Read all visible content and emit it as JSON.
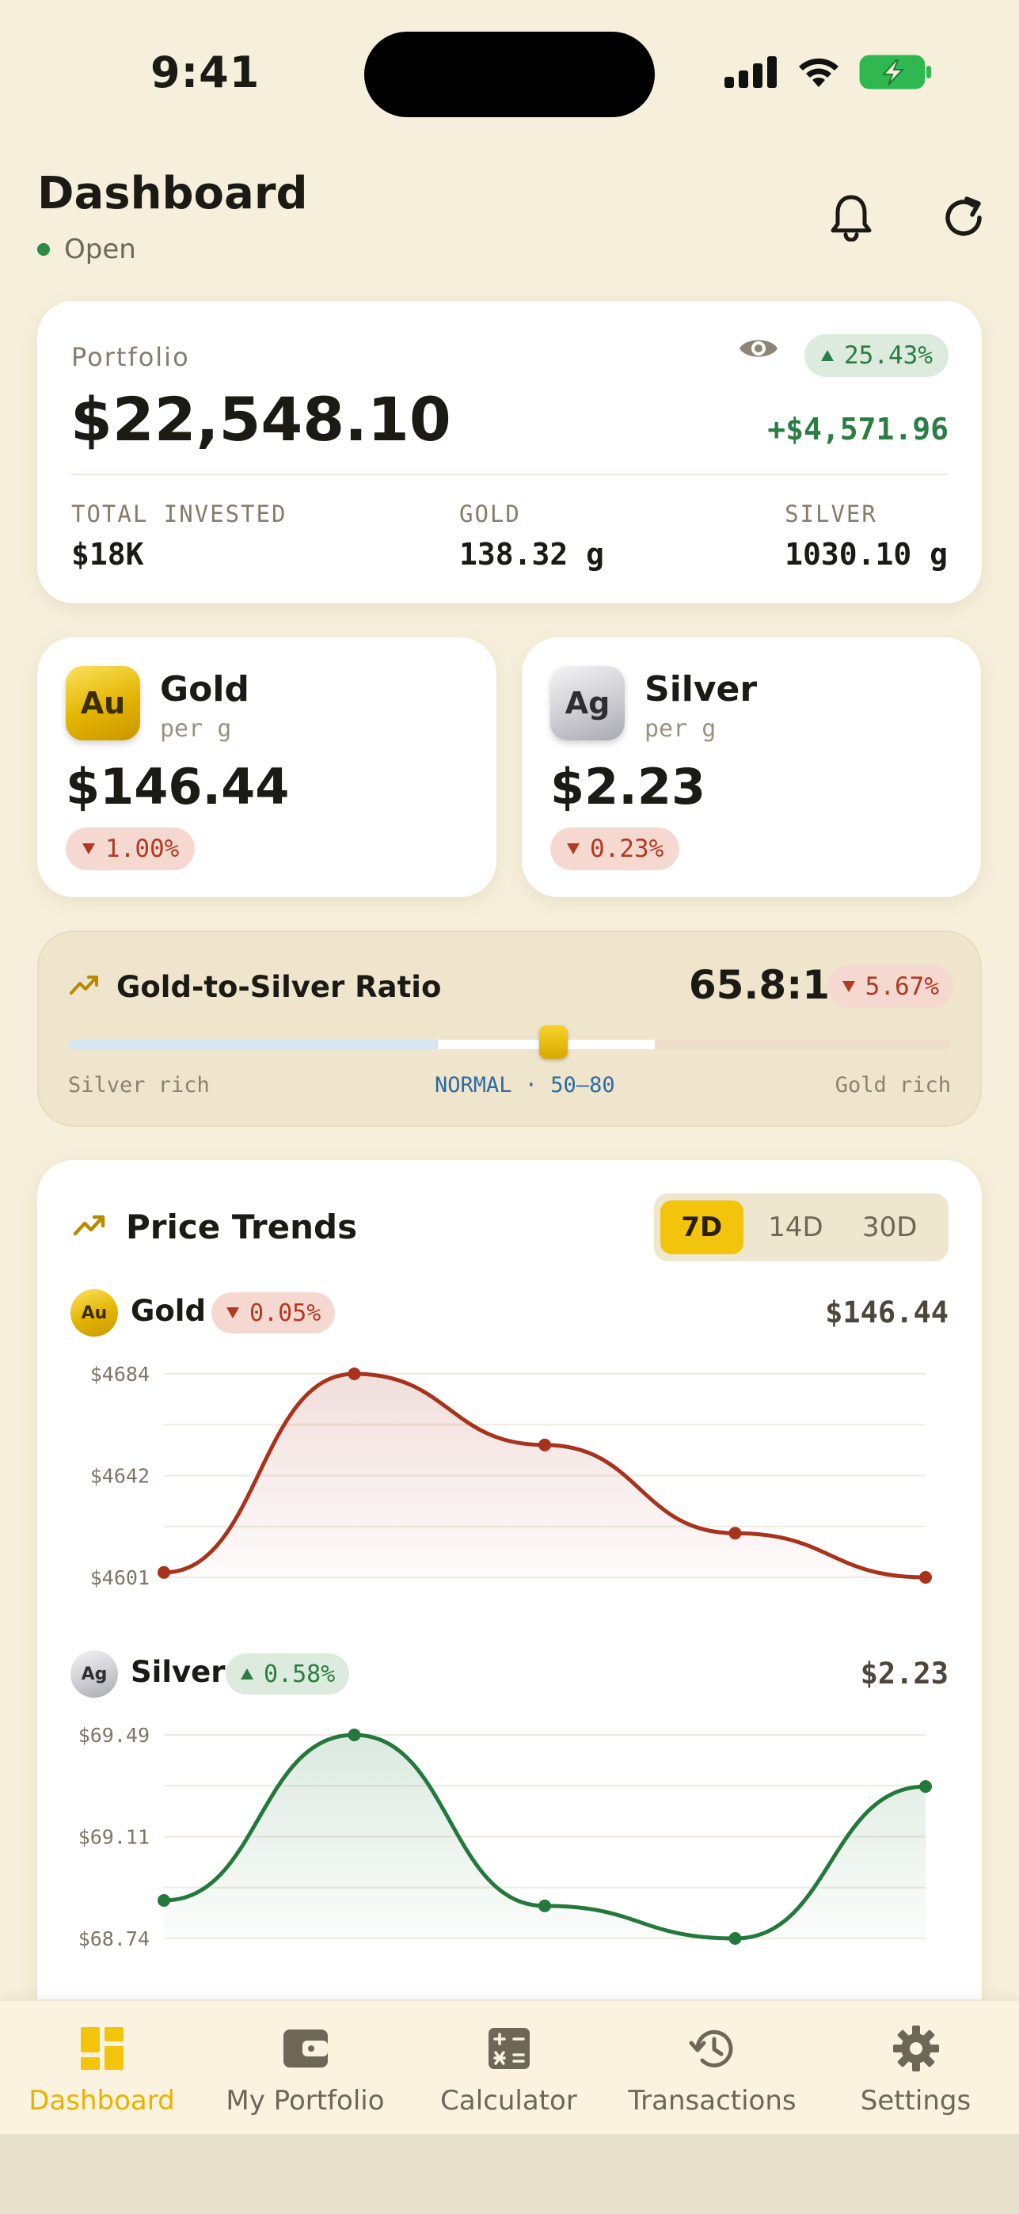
{
  "status_bar": {
    "time": "9:41"
  },
  "header": {
    "title": "Dashboard",
    "market_status": "Open"
  },
  "portfolio": {
    "label": "Portfolio",
    "value": "$22,548.10",
    "change_pct": "25.43%",
    "change_amount": "+$4,571.96",
    "stats": [
      {
        "label": "TOTAL INVESTED",
        "value": "$18K"
      },
      {
        "label": "GOLD",
        "value": "138.32 g"
      },
      {
        "label": "SILVER",
        "value": "1030.10 g"
      }
    ]
  },
  "metals": [
    {
      "symbol": "Au",
      "name": "Gold",
      "unit": "per g",
      "price": "$146.44",
      "change": "1.00%",
      "direction": "down"
    },
    {
      "symbol": "Ag",
      "name": "Silver",
      "unit": "per g",
      "price": "$2.23",
      "change": "0.23%",
      "direction": "down"
    }
  ],
  "ratio": {
    "title": "Gold-to-Silver Ratio",
    "value": "65.8:1",
    "change": "5.67%",
    "direction": "down",
    "left_label": "Silver rich",
    "center_label": "NORMAL · 50–80",
    "right_label": "Gold rich",
    "normal_range": [
      50,
      80
    ]
  },
  "trends": {
    "title": "Price Trends",
    "tabs": [
      {
        "label": "7D",
        "active": true
      },
      {
        "label": "14D",
        "active": false
      },
      {
        "label": "30D",
        "active": false
      }
    ],
    "gold": {
      "symbol": "Au",
      "name": "Gold",
      "change": "0.05%",
      "direction": "down",
      "price": "$146.44"
    },
    "silver": {
      "symbol": "Ag",
      "name": "Silver",
      "change": "0.58%",
      "direction": "up",
      "price": "$2.23"
    }
  },
  "chart_data": [
    {
      "type": "area",
      "series": [
        {
          "name": "Gold",
          "values": [
            4603,
            4684,
            4655,
            4619,
            4601
          ]
        }
      ],
      "y_ticks": [
        "$4684",
        "$4642",
        "$4601"
      ],
      "ylim": [
        4601,
        4684
      ],
      "grid": true,
      "color": "#a8331d"
    },
    {
      "type": "area",
      "series": [
        {
          "name": "Silver",
          "values": [
            68.88,
            69.49,
            68.86,
            68.74,
            69.3
          ]
        }
      ],
      "y_ticks": [
        "$69.49",
        "$69.11",
        "$68.74"
      ],
      "ylim": [
        68.74,
        69.49
      ],
      "grid": true,
      "color": "#24783b"
    }
  ],
  "tab_bar": [
    {
      "label": "Dashboard",
      "icon": "dashboard-grid-icon",
      "active": true
    },
    {
      "label": "My Portfolio",
      "icon": "wallet-icon",
      "active": false
    },
    {
      "label": "Calculator",
      "icon": "calculator-icon",
      "active": false
    },
    {
      "label": "Transactions",
      "icon": "history-icon",
      "active": false
    },
    {
      "label": "Settings",
      "icon": "gear-icon",
      "active": false
    }
  ]
}
